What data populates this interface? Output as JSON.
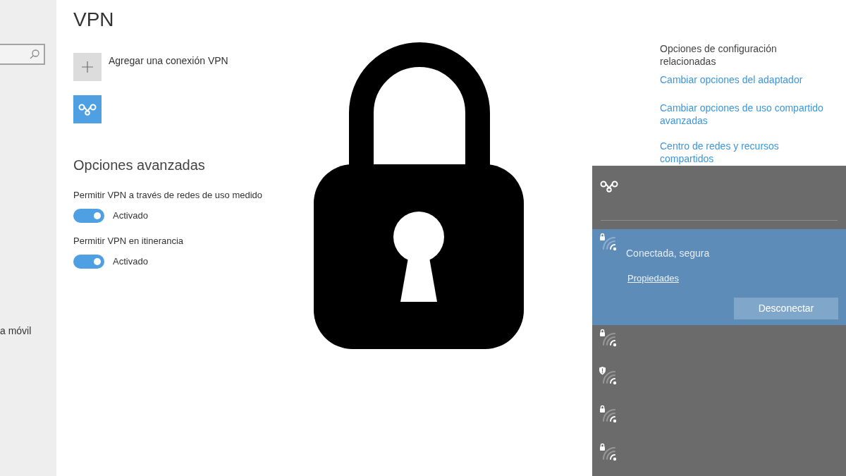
{
  "sidebar": {
    "items": [
      {
        "label": "a móvil"
      }
    ]
  },
  "page": {
    "title": "VPN",
    "add_connection": {
      "label": "Agregar una conexión VPN"
    }
  },
  "advanced": {
    "heading": "Opciones avanzadas",
    "toggles": [
      {
        "label": "Permitir VPN a través de redes de uso medido",
        "on": true,
        "state_text": "Activado"
      },
      {
        "label": "Permitir VPN en itinerancia",
        "on": true,
        "state_text": "Activado"
      }
    ]
  },
  "related": {
    "heading": "Opciones de configuración relacionadas",
    "links": [
      "Cambiar opciones del adaptador",
      "Cambiar opciones de uso compartido avanzadas",
      "Centro de redes y recursos compartidos"
    ]
  },
  "network_flyout": {
    "networks": [
      {
        "selected": true,
        "secured": true,
        "status": "Conectada, segura",
        "link": "Propiedades",
        "button": "Desconectar"
      },
      {
        "selected": false,
        "secured": true
      },
      {
        "selected": false,
        "secured": false
      },
      {
        "selected": false,
        "secured": true
      },
      {
        "selected": false,
        "secured": true
      }
    ]
  }
}
